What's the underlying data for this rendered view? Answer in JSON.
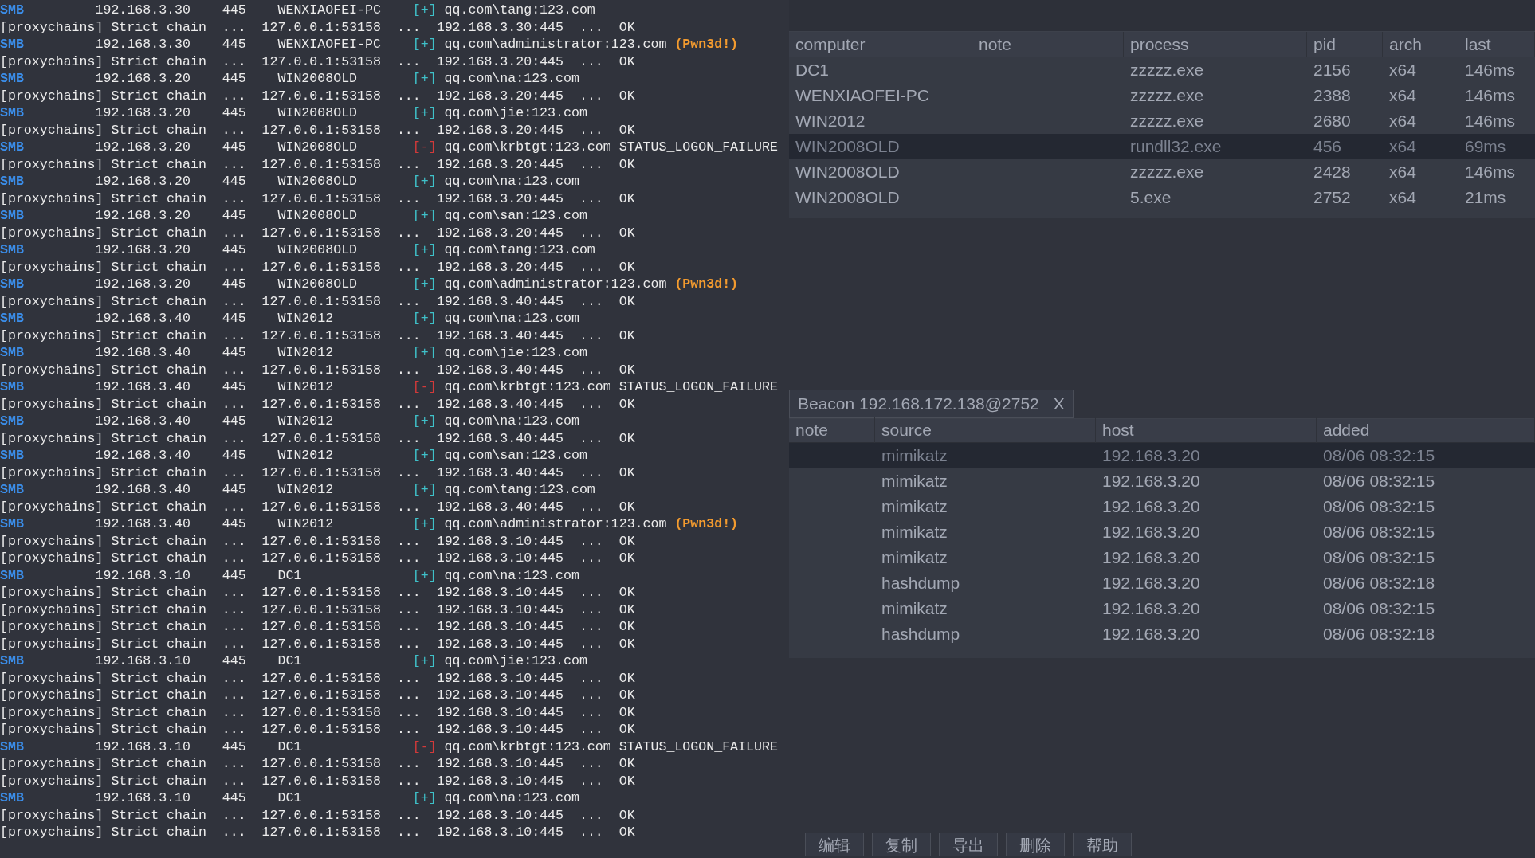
{
  "terminal": {
    "lines": [
      {
        "kind": "smb",
        "protocol": "SMB",
        "ip": "192.168.3.30",
        "port": "445",
        "host": "WENXIAOFEI-PC",
        "marker": "[+]",
        "failed": false,
        "account": "qq.com\\tang:123.com"
      },
      {
        "kind": "proxy",
        "text": "[proxychains] Strict chain  ...  127.0.0.1:53158  ...  192.168.3.30:445  ...  OK"
      },
      {
        "kind": "smb",
        "protocol": "SMB",
        "ip": "192.168.3.30",
        "port": "445",
        "host": "WENXIAOFEI-PC",
        "marker": "[+]",
        "failed": false,
        "account": "qq.com\\administrator:123.com",
        "note": "(Pwn3d!)"
      },
      {
        "kind": "proxy",
        "text": "[proxychains] Strict chain  ...  127.0.0.1:53158  ...  192.168.3.20:445  ...  OK"
      },
      {
        "kind": "smb",
        "protocol": "SMB",
        "ip": "192.168.3.20",
        "port": "445",
        "host": "WIN2008OLD",
        "marker": "[+]",
        "failed": false,
        "account": "qq.com\\na:123.com"
      },
      {
        "kind": "proxy",
        "text": "[proxychains] Strict chain  ...  127.0.0.1:53158  ...  192.168.3.20:445  ...  OK"
      },
      {
        "kind": "smb",
        "protocol": "SMB",
        "ip": "192.168.3.20",
        "port": "445",
        "host": "WIN2008OLD",
        "marker": "[+]",
        "failed": false,
        "account": "qq.com\\jie:123.com"
      },
      {
        "kind": "proxy",
        "text": "[proxychains] Strict chain  ...  127.0.0.1:53158  ...  192.168.3.20:445  ...  OK"
      },
      {
        "kind": "smb",
        "protocol": "SMB",
        "ip": "192.168.3.20",
        "port": "445",
        "host": "WIN2008OLD",
        "marker": "[-]",
        "failed": true,
        "account": "qq.com\\krbtgt:123.com STATUS_LOGON_FAILURE"
      },
      {
        "kind": "proxy",
        "text": "[proxychains] Strict chain  ...  127.0.0.1:53158  ...  192.168.3.20:445  ...  OK"
      },
      {
        "kind": "smb",
        "protocol": "SMB",
        "ip": "192.168.3.20",
        "port": "445",
        "host": "WIN2008OLD",
        "marker": "[+]",
        "failed": false,
        "account": "qq.com\\na:123.com"
      },
      {
        "kind": "proxy",
        "text": "[proxychains] Strict chain  ...  127.0.0.1:53158  ...  192.168.3.20:445  ...  OK"
      },
      {
        "kind": "smb",
        "protocol": "SMB",
        "ip": "192.168.3.20",
        "port": "445",
        "host": "WIN2008OLD",
        "marker": "[+]",
        "failed": false,
        "account": "qq.com\\san:123.com"
      },
      {
        "kind": "proxy",
        "text": "[proxychains] Strict chain  ...  127.0.0.1:53158  ...  192.168.3.20:445  ...  OK"
      },
      {
        "kind": "smb",
        "protocol": "SMB",
        "ip": "192.168.3.20",
        "port": "445",
        "host": "WIN2008OLD",
        "marker": "[+]",
        "failed": false,
        "account": "qq.com\\tang:123.com"
      },
      {
        "kind": "proxy",
        "text": "[proxychains] Strict chain  ...  127.0.0.1:53158  ...  192.168.3.20:445  ...  OK"
      },
      {
        "kind": "smb",
        "protocol": "SMB",
        "ip": "192.168.3.20",
        "port": "445",
        "host": "WIN2008OLD",
        "marker": "[+]",
        "failed": false,
        "account": "qq.com\\administrator:123.com",
        "note": "(Pwn3d!)"
      },
      {
        "kind": "proxy",
        "text": "[proxychains] Strict chain  ...  127.0.0.1:53158  ...  192.168.3.40:445  ...  OK"
      },
      {
        "kind": "smb",
        "protocol": "SMB",
        "ip": "192.168.3.40",
        "port": "445",
        "host": "WIN2012",
        "marker": "[+]",
        "failed": false,
        "account": "qq.com\\na:123.com"
      },
      {
        "kind": "proxy",
        "text": "[proxychains] Strict chain  ...  127.0.0.1:53158  ...  192.168.3.40:445  ...  OK"
      },
      {
        "kind": "smb",
        "protocol": "SMB",
        "ip": "192.168.3.40",
        "port": "445",
        "host": "WIN2012",
        "marker": "[+]",
        "failed": false,
        "account": "qq.com\\jie:123.com"
      },
      {
        "kind": "proxy",
        "text": "[proxychains] Strict chain  ...  127.0.0.1:53158  ...  192.168.3.40:445  ...  OK"
      },
      {
        "kind": "smb",
        "protocol": "SMB",
        "ip": "192.168.3.40",
        "port": "445",
        "host": "WIN2012",
        "marker": "[-]",
        "failed": true,
        "account": "qq.com\\krbtgt:123.com STATUS_LOGON_FAILURE"
      },
      {
        "kind": "proxy",
        "text": "[proxychains] Strict chain  ...  127.0.0.1:53158  ...  192.168.3.40:445  ...  OK"
      },
      {
        "kind": "smb",
        "protocol": "SMB",
        "ip": "192.168.3.40",
        "port": "445",
        "host": "WIN2012",
        "marker": "[+]",
        "failed": false,
        "account": "qq.com\\na:123.com"
      },
      {
        "kind": "proxy",
        "text": "[proxychains] Strict chain  ...  127.0.0.1:53158  ...  192.168.3.40:445  ...  OK"
      },
      {
        "kind": "smb",
        "protocol": "SMB",
        "ip": "192.168.3.40",
        "port": "445",
        "host": "WIN2012",
        "marker": "[+]",
        "failed": false,
        "account": "qq.com\\san:123.com"
      },
      {
        "kind": "proxy",
        "text": "[proxychains] Strict chain  ...  127.0.0.1:53158  ...  192.168.3.40:445  ...  OK"
      },
      {
        "kind": "smb",
        "protocol": "SMB",
        "ip": "192.168.3.40",
        "port": "445",
        "host": "WIN2012",
        "marker": "[+]",
        "failed": false,
        "account": "qq.com\\tang:123.com"
      },
      {
        "kind": "proxy",
        "text": "[proxychains] Strict chain  ...  127.0.0.1:53158  ...  192.168.3.40:445  ...  OK"
      },
      {
        "kind": "smb",
        "protocol": "SMB",
        "ip": "192.168.3.40",
        "port": "445",
        "host": "WIN2012",
        "marker": "[+]",
        "failed": false,
        "account": "qq.com\\administrator:123.com",
        "note": "(Pwn3d!)"
      },
      {
        "kind": "proxy",
        "text": "[proxychains] Strict chain  ...  127.0.0.1:53158  ...  192.168.3.10:445  ...  OK"
      },
      {
        "kind": "proxy",
        "text": "[proxychains] Strict chain  ...  127.0.0.1:53158  ...  192.168.3.10:445  ...  OK"
      },
      {
        "kind": "smb",
        "protocol": "SMB",
        "ip": "192.168.3.10",
        "port": "445",
        "host": "DC1",
        "marker": "[+]",
        "failed": false,
        "account": "qq.com\\na:123.com"
      },
      {
        "kind": "proxy",
        "text": "[proxychains] Strict chain  ...  127.0.0.1:53158  ...  192.168.3.10:445  ...  OK"
      },
      {
        "kind": "proxy",
        "text": "[proxychains] Strict chain  ...  127.0.0.1:53158  ...  192.168.3.10:445  ...  OK"
      },
      {
        "kind": "proxy",
        "text": "[proxychains] Strict chain  ...  127.0.0.1:53158  ...  192.168.3.10:445  ...  OK"
      },
      {
        "kind": "proxy",
        "text": "[proxychains] Strict chain  ...  127.0.0.1:53158  ...  192.168.3.10:445  ...  OK"
      },
      {
        "kind": "smb",
        "protocol": "SMB",
        "ip": "192.168.3.10",
        "port": "445",
        "host": "DC1",
        "marker": "[+]",
        "failed": false,
        "account": "qq.com\\jie:123.com"
      },
      {
        "kind": "proxy",
        "text": "[proxychains] Strict chain  ...  127.0.0.1:53158  ...  192.168.3.10:445  ...  OK"
      },
      {
        "kind": "proxy",
        "text": "[proxychains] Strict chain  ...  127.0.0.1:53158  ...  192.168.3.10:445  ...  OK"
      },
      {
        "kind": "proxy",
        "text": "[proxychains] Strict chain  ...  127.0.0.1:53158  ...  192.168.3.10:445  ...  OK"
      },
      {
        "kind": "proxy",
        "text": "[proxychains] Strict chain  ...  127.0.0.1:53158  ...  192.168.3.10:445  ...  OK"
      },
      {
        "kind": "smb",
        "protocol": "SMB",
        "ip": "192.168.3.10",
        "port": "445",
        "host": "DC1",
        "marker": "[-]",
        "failed": true,
        "account": "qq.com\\krbtgt:123.com STATUS_LOGON_FAILURE"
      },
      {
        "kind": "proxy",
        "text": "[proxychains] Strict chain  ...  127.0.0.1:53158  ...  192.168.3.10:445  ...  OK"
      },
      {
        "kind": "proxy",
        "text": "[proxychains] Strict chain  ...  127.0.0.1:53158  ...  192.168.3.10:445  ...  OK"
      },
      {
        "kind": "smb",
        "protocol": "SMB",
        "ip": "192.168.3.10",
        "port": "445",
        "host": "DC1",
        "marker": "[+]",
        "failed": false,
        "account": "qq.com\\na:123.com"
      },
      {
        "kind": "proxy",
        "text": "[proxychains] Strict chain  ...  127.0.0.1:53158  ...  192.168.3.10:445  ...  OK"
      },
      {
        "kind": "proxy",
        "text": "[proxychains] Strict chain  ...  127.0.0.1:53158  ...  192.168.3.10:445  ...  OK"
      }
    ]
  },
  "beacons": {
    "columns": [
      "computer",
      "note",
      "process",
      "pid",
      "arch",
      "last"
    ],
    "rows": [
      {
        "computer": "DC1",
        "process": "zzzzz.exe",
        "pid": "2156",
        "arch": "x64",
        "last": "146ms",
        "selected": false
      },
      {
        "computer": "WENXIAOFEI-PC",
        "process": "zzzzz.exe",
        "pid": "2388",
        "arch": "x64",
        "last": "146ms",
        "selected": false
      },
      {
        "computer": "WIN2012",
        "process": "zzzzz.exe",
        "pid": "2680",
        "arch": "x64",
        "last": "146ms",
        "selected": false
      },
      {
        "computer": "WIN2008OLD",
        "process": "rundll32.exe",
        "pid": "456",
        "arch": "x64",
        "last": "69ms",
        "selected": true
      },
      {
        "computer": "WIN2008OLD",
        "process": "zzzzz.exe",
        "pid": "2428",
        "arch": "x64",
        "last": "146ms",
        "selected": false
      },
      {
        "computer": "WIN2008OLD",
        "process": "5.exe",
        "pid": "2752",
        "arch": "x64",
        "last": "21ms",
        "selected": false
      }
    ]
  },
  "credentials": {
    "tab": {
      "label": "Beacon 192.168.172.138@2752",
      "close": "X"
    },
    "columns": [
      "note",
      "source",
      "host",
      "added"
    ],
    "rows": [
      {
        "source": "mimikatz",
        "host": "192.168.3.20",
        "added": "08/06 08:32:15",
        "selected": true
      },
      {
        "source": "mimikatz",
        "host": "192.168.3.20",
        "added": "08/06 08:32:15",
        "selected": false
      },
      {
        "source": "mimikatz",
        "host": "192.168.3.20",
        "added": "08/06 08:32:15",
        "selected": false
      },
      {
        "source": "mimikatz",
        "host": "192.168.3.20",
        "added": "08/06 08:32:15",
        "selected": false
      },
      {
        "source": "mimikatz",
        "host": "192.168.3.20",
        "added": "08/06 08:32:15",
        "selected": false
      },
      {
        "source": "hashdump",
        "host": "192.168.3.20",
        "added": "08/06 08:32:18",
        "selected": false
      },
      {
        "source": "mimikatz",
        "host": "192.168.3.20",
        "added": "08/06 08:32:15",
        "selected": false
      },
      {
        "source": "hashdump",
        "host": "192.168.3.20",
        "added": "08/06 08:32:18",
        "selected": false
      }
    ],
    "buttons": [
      "编辑",
      "复制",
      "导出",
      "删除",
      "帮助"
    ]
  }
}
